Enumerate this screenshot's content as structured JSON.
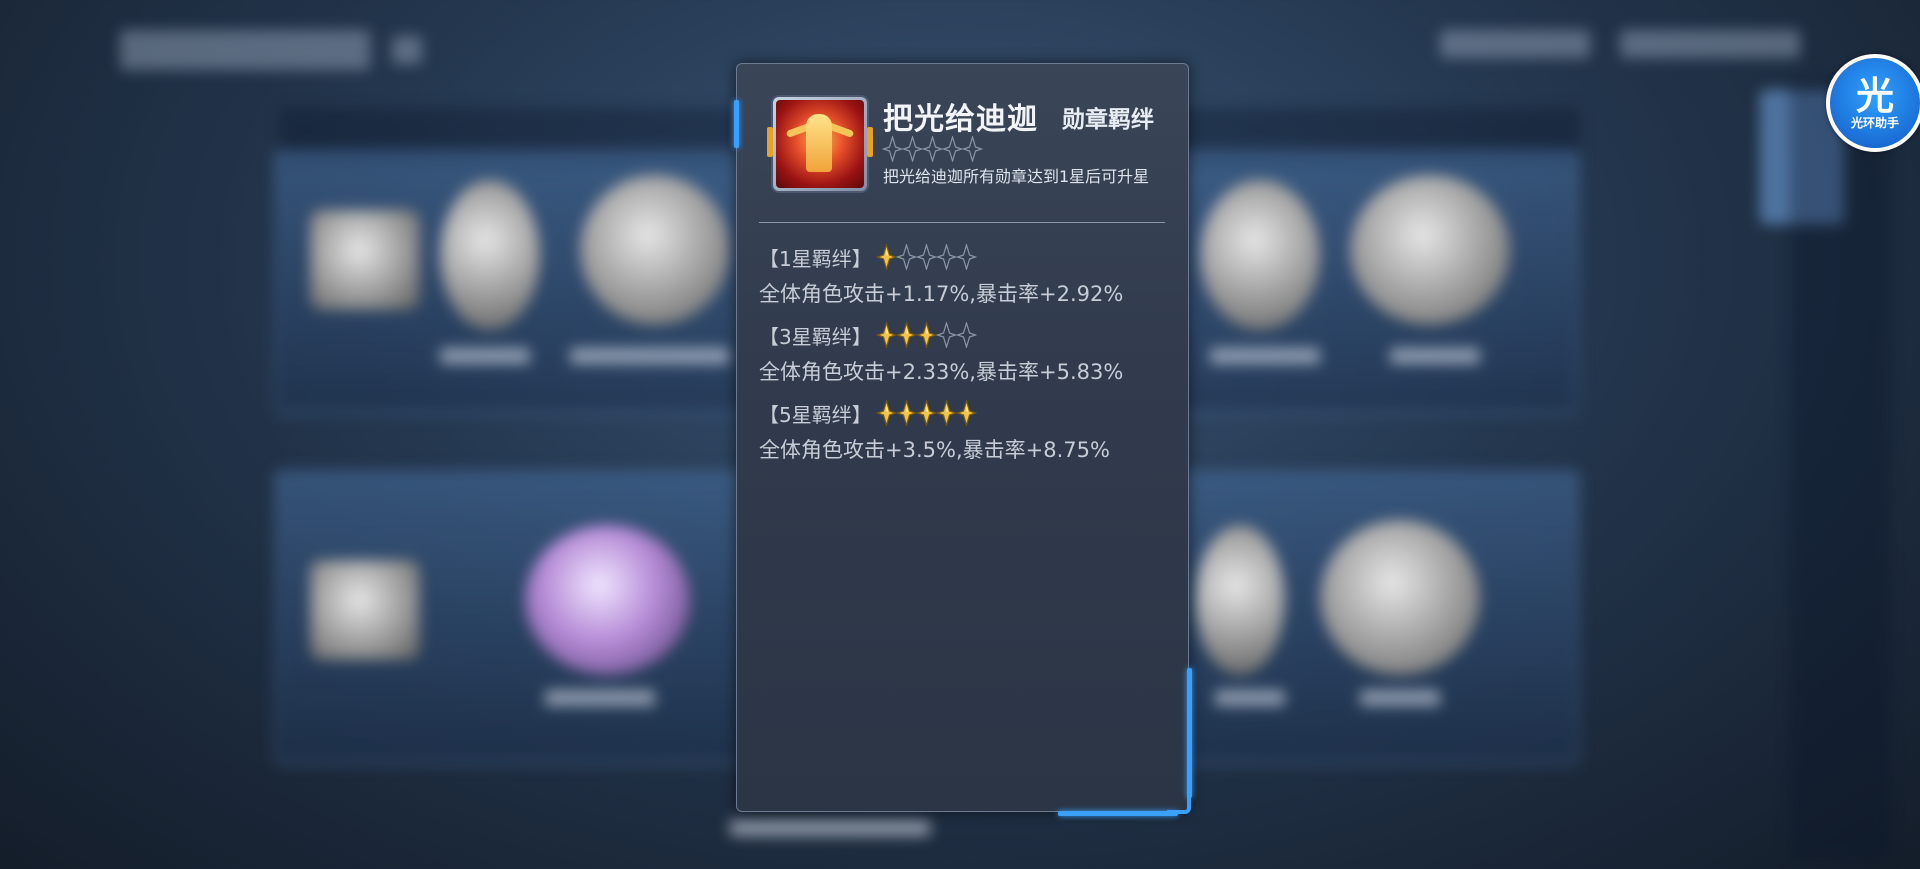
{
  "helper": {
    "big": "光",
    "small": "光环助手"
  },
  "popup": {
    "title": "把光给迪迦",
    "tag": "勋章羁绊",
    "current_stars": 0,
    "max_stars": 5,
    "description": "把光给迪迦所有勋章达到1星后可升星",
    "bonds": [
      {
        "title": "【1星羁绊】",
        "stars_filled": 1,
        "effect": "全体角色攻击+1.17%,暴击率+2.92%"
      },
      {
        "title": "【3星羁绊】",
        "stars_filled": 3,
        "effect": "全体角色攻击+2.33%,暴击率+5.83%"
      },
      {
        "title": "【5星羁绊】",
        "stars_filled": 5,
        "effect": "全体角色攻击+3.5%,暴击率+8.75%"
      }
    ]
  },
  "colors": {
    "accent": "#3aa0ff",
    "star_gold": "#f2c54a",
    "star_empty": "#8d96a6"
  },
  "icons": {
    "medal": "ultraman-medal-icon",
    "star": "star-icon"
  }
}
